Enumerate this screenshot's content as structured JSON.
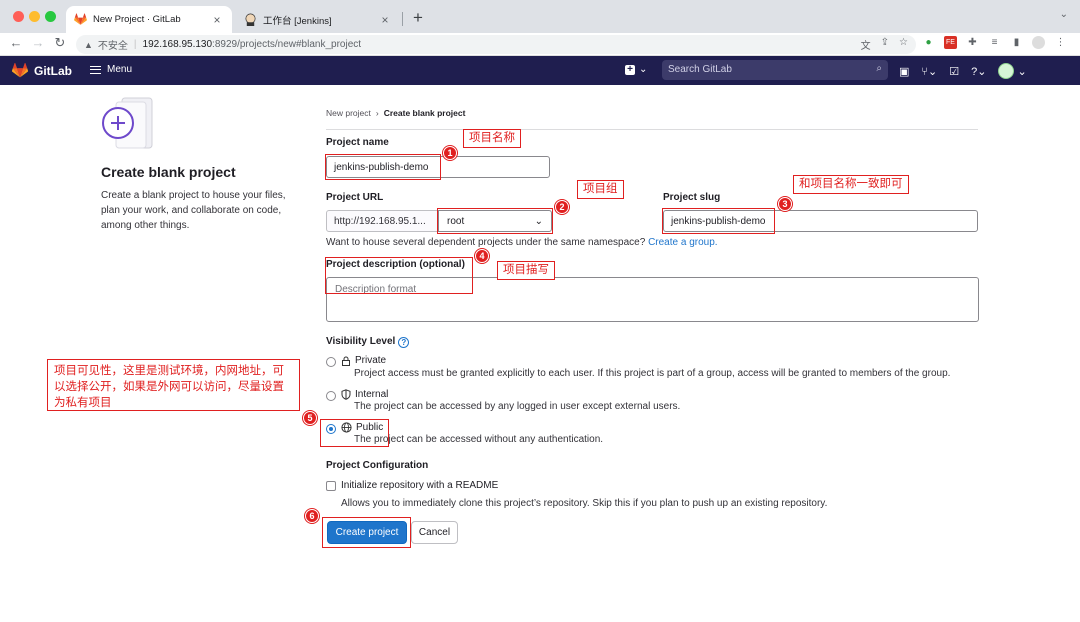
{
  "browser": {
    "tabs": [
      {
        "title": "New Project · GitLab",
        "active": true
      },
      {
        "title": "工作台 [Jenkins]",
        "active": false
      }
    ],
    "address": {
      "security": "不安全",
      "host": "192.168.95.130",
      "path": ":8929/projects/new#blank_project"
    }
  },
  "gitlab_nav": {
    "brand": "GitLab",
    "menu_label": "Menu",
    "search_placeholder": "Search GitLab"
  },
  "intro": {
    "title": "Create blank project",
    "description": "Create a blank project to house your files, plan your work, and collaborate on code, among other things."
  },
  "breadcrumb": {
    "parent": "New project",
    "current": "Create blank project"
  },
  "form": {
    "project_name_label": "Project name",
    "project_name_value": "jenkins-publish-demo",
    "project_url_label": "Project URL",
    "project_url_prefix": "http://192.168.95.1...",
    "namespace_value": "root",
    "project_slug_label": "Project slug",
    "project_slug_value": "jenkins-publish-demo",
    "namespace_help": "Want to house several dependent projects under the same namespace?",
    "namespace_help_link": "Create a group.",
    "description_label": "Project description (optional)",
    "description_placeholder": "Description format",
    "visibility_label": "Visibility Level",
    "visibility_options": [
      {
        "title": "Private",
        "desc": "Project access must be granted explicitly to each user. If this project is part of a group, access will be granted to members of the group.",
        "checked": false
      },
      {
        "title": "Internal",
        "desc": "The project can be accessed by any logged in user except external users.",
        "checked": false
      },
      {
        "title": "Public",
        "desc": "The project can be accessed without any authentication.",
        "checked": true
      }
    ],
    "config_label": "Project Configuration",
    "readme_label": "Initialize repository with a README",
    "readme_desc": "Allows you to immediately clone this project’s repository. Skip this if you plan to push up an existing repository.",
    "create_button": "Create project",
    "cancel_button": "Cancel"
  },
  "annotations": {
    "note_1": "项目名称",
    "note_2": "项目组",
    "note_3": "和项目名称一致即可",
    "note_4": "项目描写",
    "note_5": "项目可见性，这里是测试环境，内网地址，可以选择公开，如果是外网可以访问，尽量设置为私有项目",
    "markers": [
      "1",
      "2",
      "3",
      "4",
      "5",
      "6"
    ]
  }
}
